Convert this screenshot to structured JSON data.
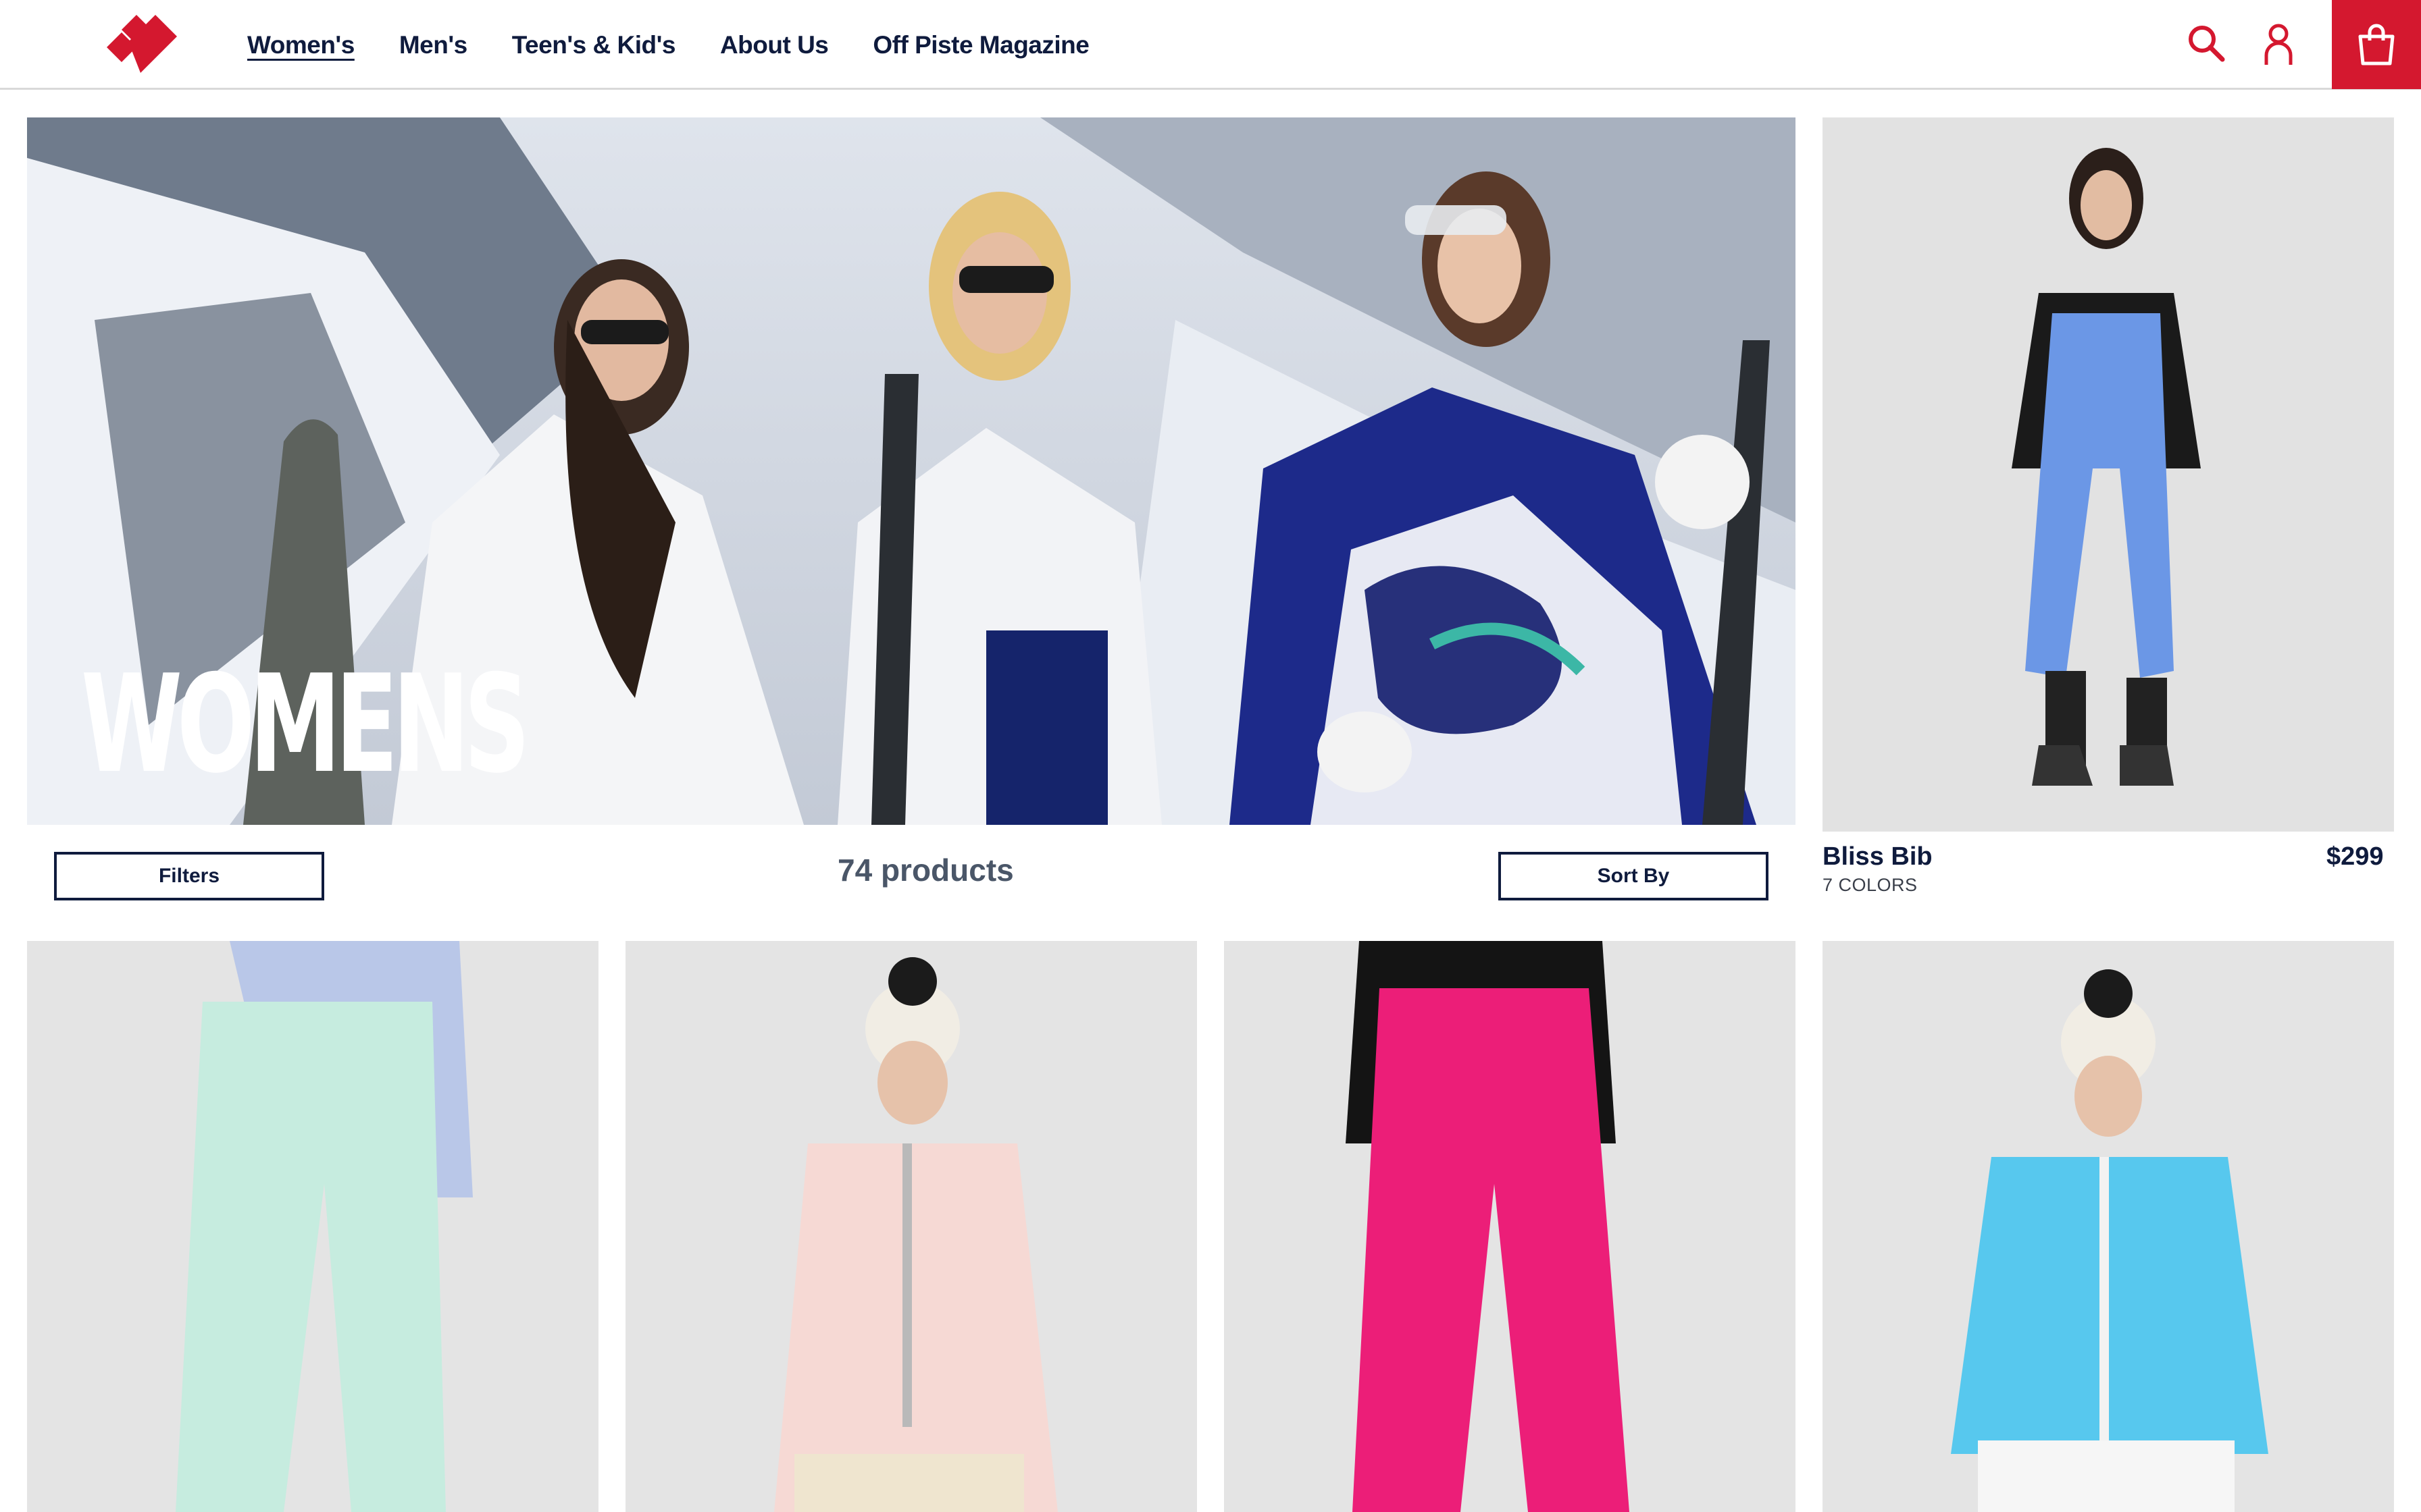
{
  "brand": {
    "color": "#d4182f",
    "logo_icon": "diamond-logo-icon"
  },
  "nav": [
    {
      "label": "Women's",
      "active": true
    },
    {
      "label": "Men's"
    },
    {
      "label": "Teen's & Kid's"
    },
    {
      "label": "About Us"
    },
    {
      "label": "Off Piste Magazine"
    }
  ],
  "header_icons": [
    "search-icon",
    "account-icon",
    "shopping-bag-icon"
  ],
  "hero": {
    "title": "WOMENS"
  },
  "toolbar": {
    "filters_label": "Filters",
    "product_count": "74 products",
    "sort_label": "Sort By"
  },
  "featured_product": {
    "name": "Bliss Bib",
    "colors": "7 COLORS",
    "price": "$299",
    "color": "#6b97e6"
  },
  "grid_products": [
    {
      "color": "#c6ecdf"
    },
    {
      "color": "#f6d9d4"
    },
    {
      "color": "#ec1e78"
    },
    {
      "color": "#57c8ee"
    }
  ]
}
